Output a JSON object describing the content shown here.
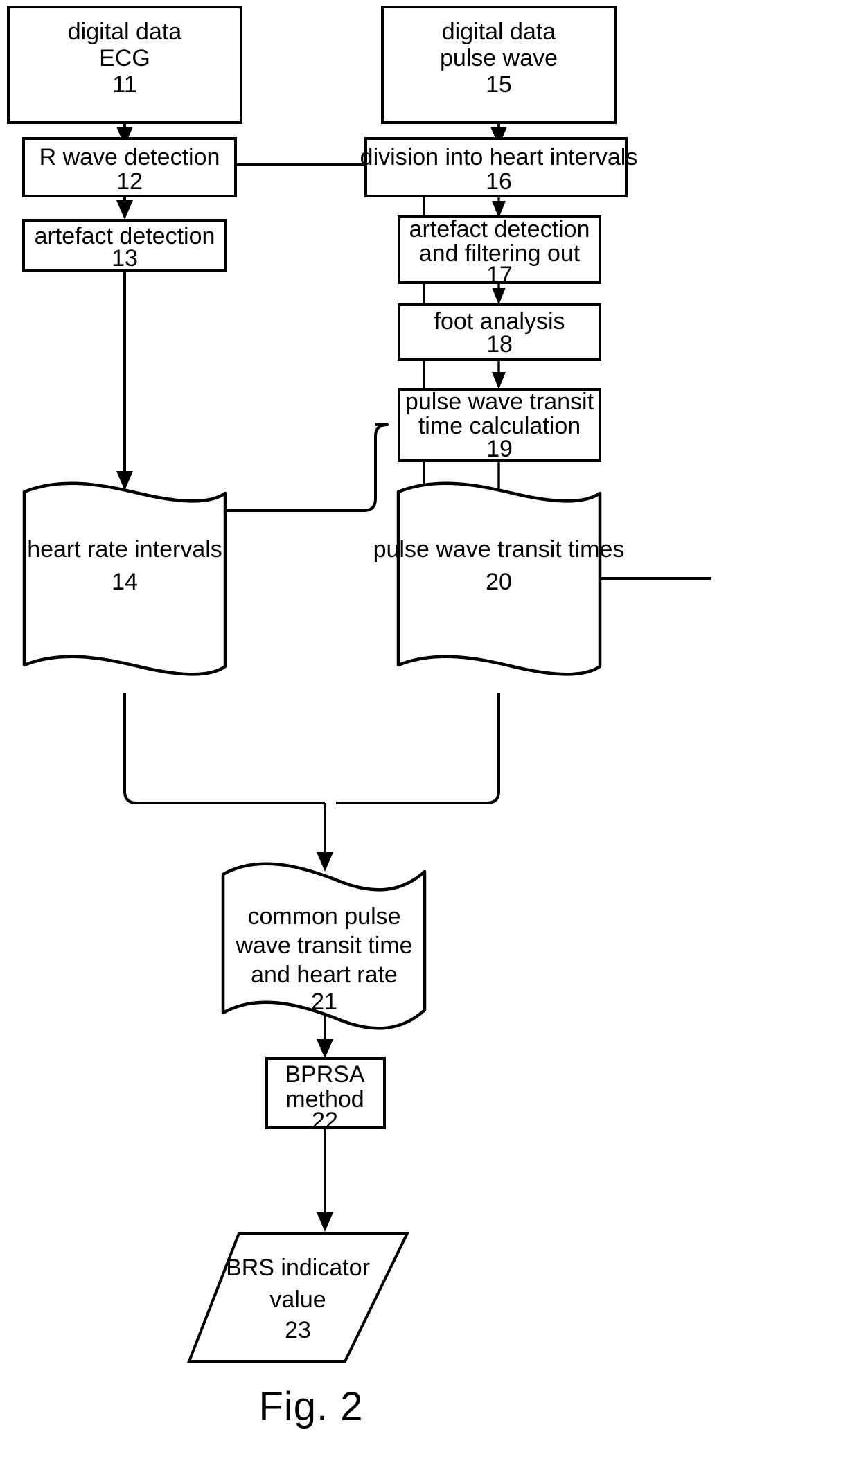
{
  "figure": {
    "caption": "Fig. 2",
    "title": "BRS indicator determination flowchart"
  },
  "nodes": {
    "n11": {
      "line1": "digital data",
      "line2": "ECG",
      "ref": "11",
      "shape": "rectangle"
    },
    "n12": {
      "line1": "R wave detection",
      "ref": "12",
      "shape": "rectangle"
    },
    "n13": {
      "line1": "artefact detection",
      "ref": "13",
      "shape": "rectangle"
    },
    "n14": {
      "line1": "heart rate intervals",
      "ref": "14",
      "shape": "wavy-banner"
    },
    "n15": {
      "line1": "digital data",
      "line2": "pulse wave",
      "ref": "15",
      "shape": "rectangle"
    },
    "n16": {
      "line1": "division into heart intervals",
      "ref": "16",
      "shape": "rectangle"
    },
    "n17": {
      "line1": "artefact detection",
      "line2": "and filtering out",
      "ref": "17",
      "shape": "rectangle"
    },
    "n18": {
      "line1": "foot analysis",
      "ref": "18",
      "shape": "rectangle"
    },
    "n19": {
      "line1": "pulse wave transit",
      "line2": "time calculation",
      "ref": "19",
      "shape": "rectangle"
    },
    "n20": {
      "line1": "pulse wave transit times",
      "ref": "20",
      "shape": "wavy-banner"
    },
    "n21": {
      "line1": "common pulse",
      "line2": "wave transit time",
      "line3": "and heart rate",
      "ref": "21",
      "shape": "wavy-banner"
    },
    "n22": {
      "line1": "BPRSA",
      "line2": "method",
      "ref": "22",
      "shape": "rectangle"
    },
    "n23": {
      "line1": "BRS indicator",
      "line2": "value",
      "ref": "23",
      "shape": "parallelogram"
    }
  },
  "edges": [
    {
      "name": "edge-11-to-12",
      "from": "11",
      "to": "12"
    },
    {
      "name": "edge-12-to-13",
      "from": "12",
      "to": "13"
    },
    {
      "name": "edge-13-to-14",
      "from": "13",
      "to": "14"
    },
    {
      "name": "edge-12-to-16",
      "from": "12",
      "to": "16"
    },
    {
      "name": "edge-15-to-16",
      "from": "15",
      "to": "16"
    },
    {
      "name": "edge-16-to-17",
      "from": "16",
      "to": "17"
    },
    {
      "name": "edge-17-to-18",
      "from": "17",
      "to": "18"
    },
    {
      "name": "edge-18-to-19",
      "from": "18",
      "to": "19"
    },
    {
      "name": "edge-14-to-19",
      "from": "14",
      "to": "19"
    },
    {
      "name": "edge-19-to-20",
      "from": "19",
      "to": "20"
    },
    {
      "name": "edge-14-to-21",
      "from": "14",
      "to": "21"
    },
    {
      "name": "edge-20-to-21",
      "from": "20",
      "to": "21"
    },
    {
      "name": "edge-21-to-22",
      "from": "21",
      "to": "22"
    },
    {
      "name": "edge-22-to-23",
      "from": "22",
      "to": "23"
    }
  ],
  "colors": {
    "stroke": "#000000",
    "fill": "#ffffff",
    "background": "#ffffff"
  }
}
